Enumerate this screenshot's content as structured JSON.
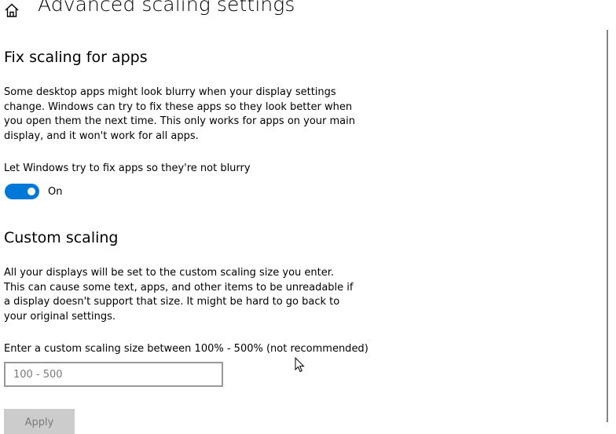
{
  "header": {
    "title": "Advanced scaling settings",
    "home_icon": "home-icon"
  },
  "fix_scaling": {
    "title": "Fix scaling for apps",
    "description": "Some desktop apps might look blurry when your display settings change. Windows can try to fix these apps so they look better when you open them the next time. This only works for apps on your main display, and it won't work for all apps.",
    "toggle_label": "Let Windows try to fix apps so they're not blurry",
    "toggle_state": "On",
    "toggle_on": true,
    "toggle_color": "#0078d7"
  },
  "custom_scaling": {
    "title": "Custom scaling",
    "description": "All your displays will be set to the custom scaling size you enter. This can cause some text, apps, and other items to be unreadable if a display doesn't support that size. It might be hard to go back to your original settings.",
    "input_label": "Enter a custom scaling size between 100% - 500% (not recommended)",
    "input_value": "",
    "input_placeholder": "100 - 500",
    "apply_label": "Apply",
    "apply_enabled": false
  }
}
